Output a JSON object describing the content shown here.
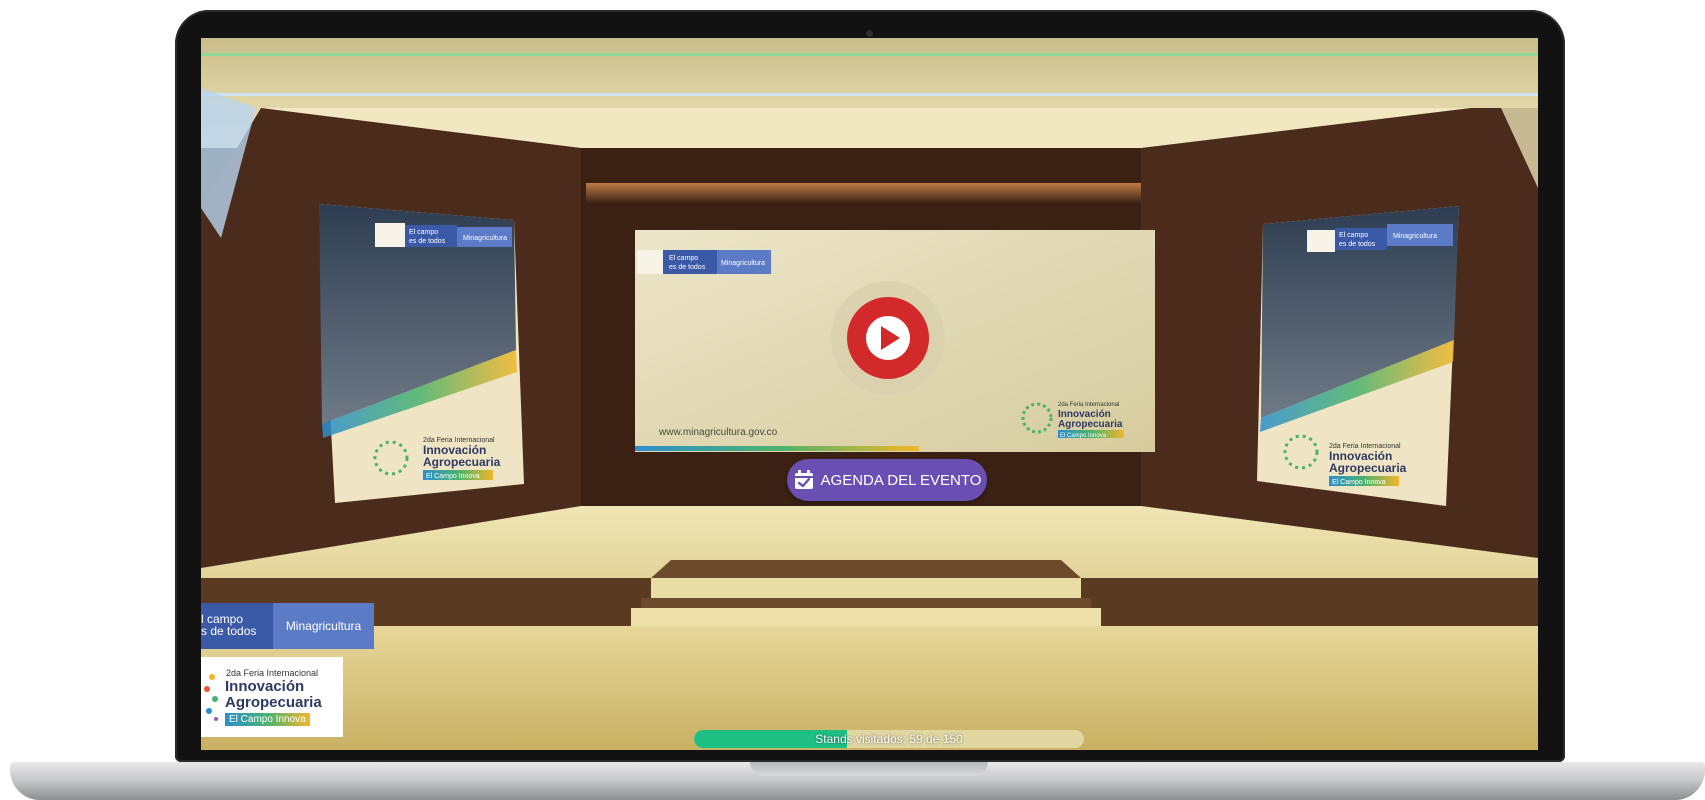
{
  "agenda_button": {
    "label": "AGENDA DEL EVENTO"
  },
  "logo_bar": {
    "left_line1": "l campo",
    "left_line2": "s de todos",
    "right": "Minagricultura"
  },
  "feria": {
    "small": "2da Feria Internacional",
    "line1": "Innovación",
    "line2": "Agropecuaria",
    "tag": "El Campo Innova"
  },
  "screen": {
    "header_left_line1": "El campo",
    "header_left_line2": "es de todos",
    "header_right": "Minagricultura",
    "url": "www.minagricultura.gov.co",
    "feria_small": "2da Feria Internacional",
    "feria_line1": "Innovación",
    "feria_line2": "Agropecuaria",
    "feria_tag": "El Campo Innova"
  },
  "poster": {
    "header_left_line1": "El campo",
    "header_left_line2": "es de todos",
    "header_right": "Minagricultura",
    "feria_small": "2da Feria Internacional",
    "feria_line1": "Innovación",
    "feria_line2": "Agropecuaria",
    "feria_tag": "El Campo Innova"
  },
  "progress": {
    "text": "Stands visitados: 59 de 150",
    "visited": 59,
    "total": 150
  },
  "colors": {
    "accent_purple": "#6a4fb3",
    "progress_green": "#1dbf83",
    "play_red": "#d22a2a",
    "brand_blue": "#3a5aa8"
  }
}
